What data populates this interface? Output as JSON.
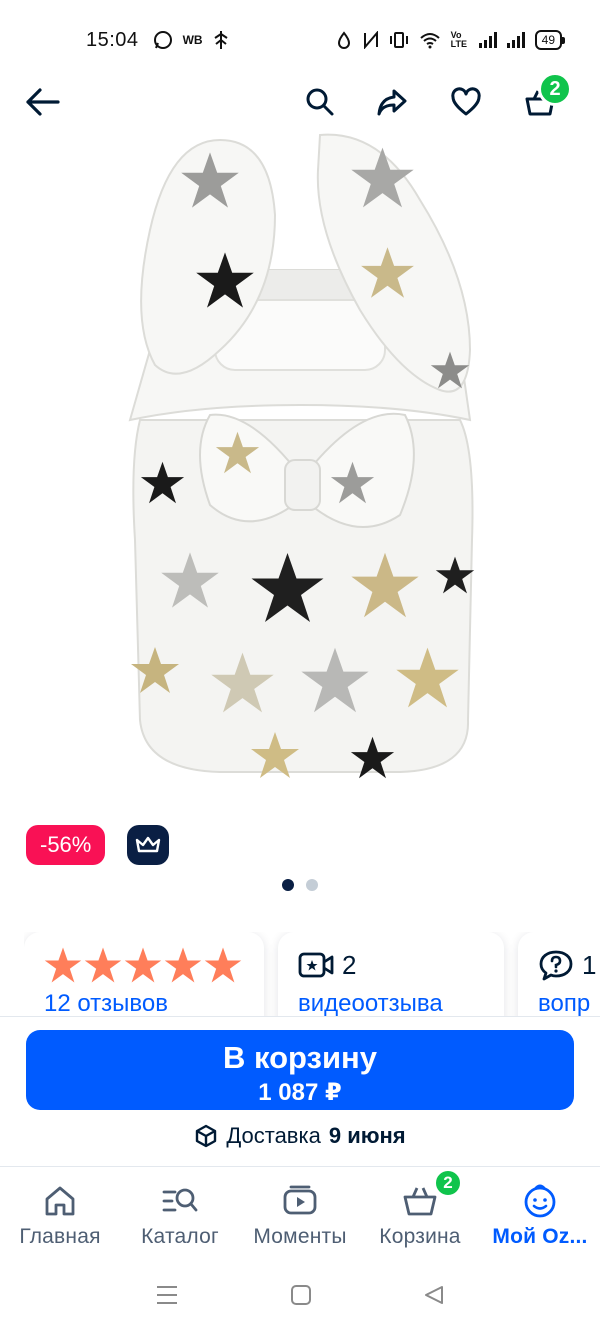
{
  "status_bar": {
    "time": "15:04",
    "wb_label": "WB",
    "network_label": "Vo LTE",
    "battery": "49"
  },
  "top_nav": {
    "cart_count": "2"
  },
  "product": {
    "discount": "-56%",
    "pager": {
      "total": 2,
      "active_index": 0
    }
  },
  "reviews": {
    "rating_stars": 5,
    "reviews_link": "12 отзывов",
    "video_count": "2",
    "video_link": "видеоотзыва",
    "questions_count": "1",
    "questions_link": "вопр"
  },
  "action": {
    "buy_label": "В корзину",
    "price": "1 087 ₽",
    "delivery_prefix": "Доставка",
    "delivery_date": "9 июня"
  },
  "tabs": [
    {
      "label": "Главная",
      "icon": "home-icon"
    },
    {
      "label": "Каталог",
      "icon": "catalog-icon"
    },
    {
      "label": "Моменты",
      "icon": "moments-icon"
    },
    {
      "label": "Корзина",
      "icon": "cart-icon",
      "badge": "2"
    },
    {
      "label": "Мой Oz...",
      "icon": "profile-icon",
      "active": true
    }
  ],
  "colors": {
    "accent": "#005bff",
    "discount": "#f91155",
    "badge_green": "#10c44c",
    "star": "#ff7e5a",
    "dark": "#0a1f44"
  }
}
